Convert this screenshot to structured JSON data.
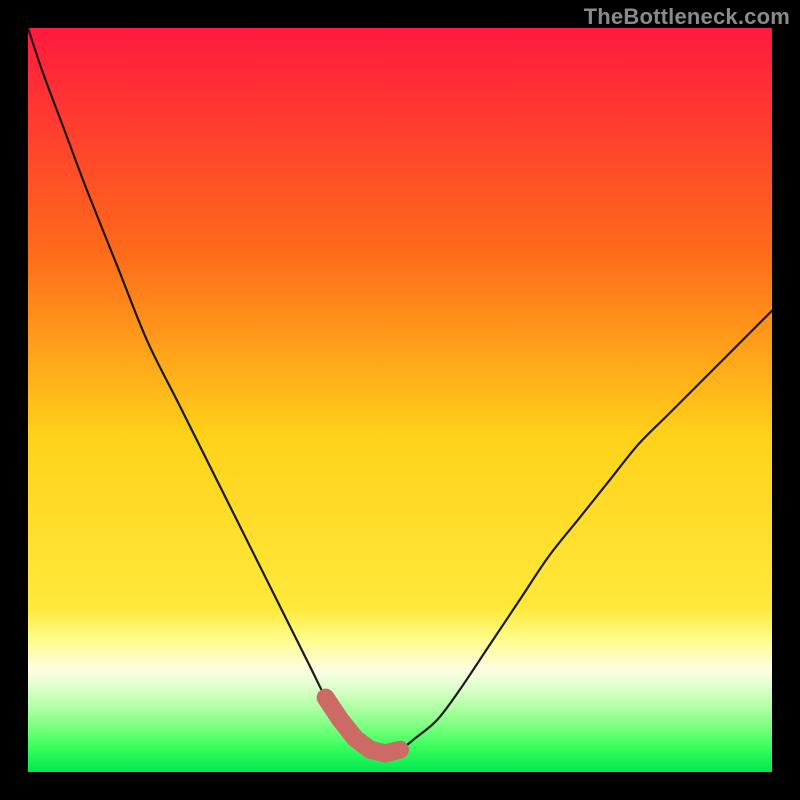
{
  "watermark": {
    "text": "TheBottleneck.com"
  },
  "colors": {
    "top": "#ff1a3f",
    "mid_warm": "#ff9a1a",
    "yellow": "#ffe93b",
    "pale_yellow": "#fffb88",
    "pale_green": "#c7ffb8",
    "mid_green": "#66ff70",
    "green": "#00e84e",
    "curve": "#1a1a1a",
    "marker": "#cc6a66",
    "frame": "#000000"
  },
  "chart_data": {
    "type": "line",
    "title": "",
    "xlabel": "",
    "ylabel": "",
    "x_range": [
      0,
      100
    ],
    "ylim": [
      0,
      100
    ],
    "series": [
      {
        "name": "bottleneck-curve",
        "x": [
          0,
          2,
          5,
          8,
          12,
          16,
          20,
          24,
          28,
          32,
          35,
          38,
          40,
          42,
          44,
          46,
          48,
          50,
          52,
          55,
          58,
          62,
          66,
          70,
          74,
          78,
          82,
          86,
          90,
          95,
          100
        ],
        "y": [
          100,
          94,
          86,
          78,
          68,
          58,
          50,
          42,
          34,
          26,
          20,
          14,
          10,
          7,
          4.5,
          3,
          2.5,
          3,
          4.5,
          7,
          11,
          17,
          23,
          29,
          34,
          39,
          44,
          48,
          52,
          57,
          62
        ]
      }
    ],
    "markers": {
      "name": "highlighted-range",
      "x": [
        40,
        42,
        44,
        46,
        48,
        50
      ],
      "y": [
        10,
        7,
        4.5,
        3,
        2.5,
        3
      ]
    },
    "gradient_bands": [
      {
        "y_pct": 0.0,
        "color": "#ff1a3f"
      },
      {
        "y_pct": 0.3,
        "color": "#ff6a1a"
      },
      {
        "y_pct": 0.55,
        "color": "#ffd21a"
      },
      {
        "y_pct": 0.78,
        "color": "#ffe93b"
      },
      {
        "y_pct": 0.82,
        "color": "#fffb88"
      },
      {
        "y_pct": 0.86,
        "color": "#fffde0"
      },
      {
        "y_pct": 0.88,
        "color": "#e6ffd6"
      },
      {
        "y_pct": 0.9,
        "color": "#c7ffb8"
      },
      {
        "y_pct": 0.92,
        "color": "#a2ff9c"
      },
      {
        "y_pct": 0.94,
        "color": "#78ff7e"
      },
      {
        "y_pct": 0.965,
        "color": "#3cff5e"
      },
      {
        "y_pct": 1.0,
        "color": "#00e84e"
      }
    ]
  }
}
